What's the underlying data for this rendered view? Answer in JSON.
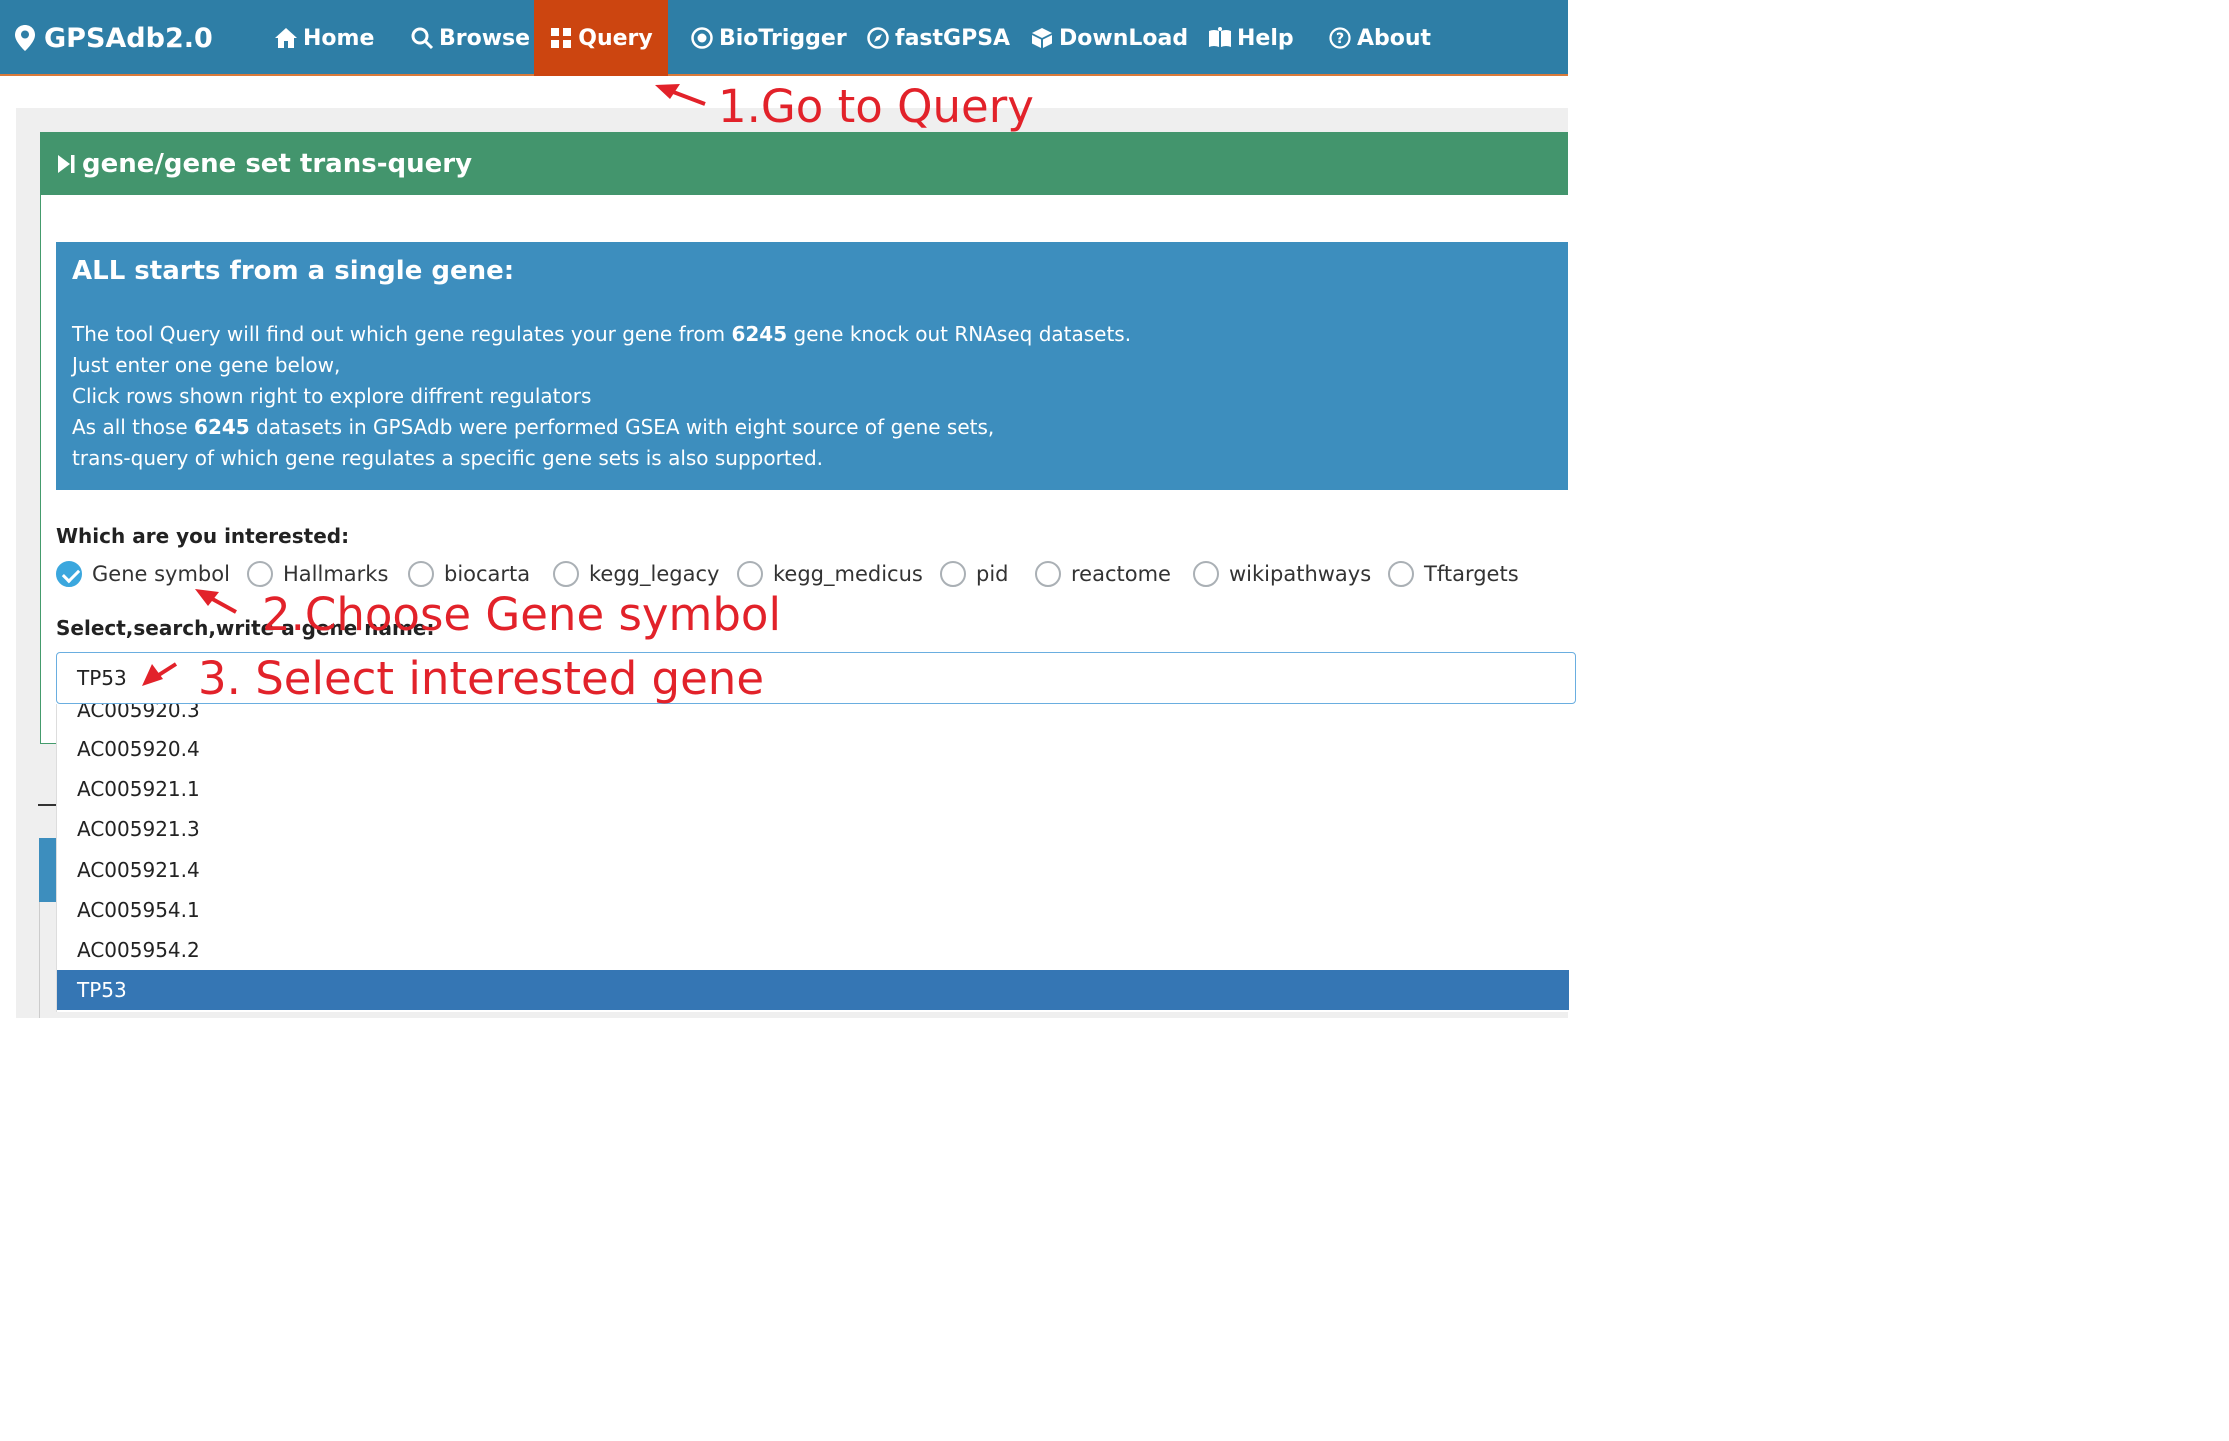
{
  "brand": {
    "name": "GPSAdb2.0",
    "icon": "map-pin-icon"
  },
  "nav": [
    {
      "label": "Home",
      "icon": "home-icon"
    },
    {
      "label": "Browse",
      "icon": "search-icon"
    },
    {
      "label": "Query",
      "icon": "query-icon",
      "active": true
    },
    {
      "label": "BioTrigger",
      "icon": "target-icon"
    },
    {
      "label": "fastGPSA",
      "icon": "compass-icon"
    },
    {
      "label": "DownLoad",
      "icon": "package-icon"
    },
    {
      "label": "Help",
      "icon": "book-icon"
    },
    {
      "label": "About",
      "icon": "question-circle-icon"
    }
  ],
  "card": {
    "title": "gene/gene set trans-query"
  },
  "info": {
    "title": "ALL starts from a single gene:",
    "lines": [
      {
        "pre": "The tool Query will find out which gene regulates your gene from ",
        "bold": "6245",
        "post": " gene knock out RNAseq datasets."
      },
      {
        "pre": "Just enter one gene below,",
        "bold": "",
        "post": ""
      },
      {
        "pre": "Click rows shown right to explore diffrent regulators",
        "bold": "",
        "post": ""
      },
      {
        "pre": "As all those ",
        "bold": "6245",
        "post": " datasets in GPSAdb were performed GSEA with eight source of gene sets,"
      },
      {
        "pre": "trans-query of which gene regulates a specific gene sets is also supported.",
        "bold": "",
        "post": ""
      }
    ]
  },
  "form": {
    "interest_label": "Which are you interested:",
    "options": [
      "Gene symbol",
      "Hallmarks",
      "biocarta",
      "kegg_legacy",
      "kegg_medicus",
      "pid",
      "reactome",
      "wikipathways",
      "Tftargets"
    ],
    "selected_option": "Gene symbol",
    "gene_label": "Select,search,write a gene name:",
    "gene_value": "TP53"
  },
  "dropdown": {
    "partial_item": "AC005920.3",
    "items": [
      "AC005920.4",
      "AC005921.1",
      "AC005921.3",
      "AC005921.4",
      "AC005954.1",
      "AC005954.2"
    ],
    "selected": "TP53"
  },
  "annotations": {
    "step1": "1.Go to Query",
    "step2": "2.Choose Gene symbol",
    "step3": "3. Select interested gene",
    "color": "#e2222a"
  },
  "colors": {
    "navbar": "#2e7ea6",
    "nav_active": "#cc4510",
    "card_header": "#43956d",
    "info_box": "#3d8ebe",
    "dropdown_selected": "#3576b4"
  }
}
